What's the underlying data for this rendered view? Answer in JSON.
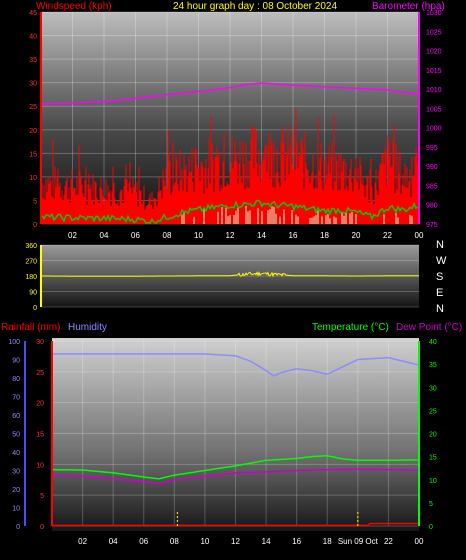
{
  "colors": {
    "background": "#000000",
    "wind_gust": "#ff0000",
    "wind_avg": "#00cc00",
    "wind_light": "#ccffcc",
    "barometer": "#ff00ff",
    "direction": "#ffff00",
    "rain": "#ff0000",
    "humidity": "#8c8cff",
    "temperature": "#00ff00",
    "dew_point": "#cc00cc",
    "axis_tick": "#ffff00",
    "left_axis_rain": "#4b4bff",
    "right_axis_temp": "#00ff00"
  },
  "chart_data": [
    {
      "id": "wind_baro",
      "type": "bar",
      "title": "24 hour graph day : 08 October 2024",
      "left_label": "Windspeed (kph)",
      "right_label": "Barometer (hpa)",
      "x_ticks": [
        "02",
        "04",
        "06",
        "08",
        "10",
        "12",
        "14",
        "16",
        "18",
        "20",
        "22",
        "00"
      ],
      "left_ticks": [
        "0",
        "5",
        "10",
        "15",
        "20",
        "25",
        "30",
        "35",
        "40",
        "45"
      ],
      "right_ticks": [
        "975",
        "980",
        "985",
        "990",
        "995",
        "1000",
        "1005",
        "1010",
        "1015",
        "1020",
        "1025",
        "1030"
      ],
      "ylim_left": [
        0,
        45
      ],
      "ylim_right": [
        975,
        1030
      ],
      "barometer": {
        "hours": [
          0,
          2,
          4,
          6,
          8,
          10,
          12,
          13,
          14,
          15,
          16,
          18,
          20,
          22,
          23,
          24
        ],
        "values": [
          1006.2,
          1006.4,
          1006.8,
          1007.6,
          1008.6,
          1009.4,
          1010.4,
          1011.2,
          1011.6,
          1011.3,
          1011.0,
          1010.6,
          1010.2,
          1009.8,
          1009.2,
          1008.8
        ]
      },
      "wind_gust_envelope": {
        "hours": [
          0,
          2,
          4,
          6,
          7,
          8,
          10,
          12,
          14,
          16,
          18,
          20,
          21,
          22,
          23,
          24
        ],
        "values": [
          13,
          12,
          11,
          10,
          7,
          15,
          18,
          20,
          22,
          21,
          18,
          16,
          10,
          20,
          15,
          16
        ]
      },
      "wind_avg": {
        "hours": [
          0,
          2,
          4,
          6,
          7,
          8,
          9,
          10,
          11,
          12,
          13,
          14,
          15,
          16,
          17,
          18,
          19,
          20,
          21,
          22,
          23,
          24
        ],
        "values": [
          1.5,
          1.3,
          1.2,
          1.0,
          0.5,
          1.5,
          2.5,
          3.0,
          3.5,
          4.0,
          4.2,
          4.5,
          4.0,
          3.8,
          3.2,
          2.8,
          3.0,
          2.5,
          1.5,
          3.5,
          3.0,
          4.0
        ]
      }
    },
    {
      "id": "direction",
      "type": "line",
      "left_ticks": [
        "0",
        "90",
        "180",
        "270",
        "360"
      ],
      "compass": [
        "N",
        "W",
        "S",
        "E",
        "N"
      ],
      "x_ticks": [],
      "ylim": [
        0,
        360
      ],
      "hours": [
        0,
        4,
        8,
        12,
        13,
        14,
        15,
        16,
        20,
        24
      ],
      "values": [
        180,
        178,
        180,
        182,
        190,
        195,
        188,
        182,
        180,
        182
      ]
    },
    {
      "id": "temp_hum",
      "type": "line",
      "rain_label": "Rainfall (mm)",
      "humidity_label": "Humidity",
      "temp_label": "Temperature (°C)",
      "dew_label": "Dew Point (°C)",
      "x_ticks": [
        "02",
        "04",
        "06",
        "08",
        "10",
        "12",
        "14",
        "16",
        "18",
        "Sun 09 Oct",
        "22",
        "00"
      ],
      "humidity_ticks": [
        "0",
        "10",
        "20",
        "30",
        "40",
        "50",
        "60",
        "70",
        "80",
        "90",
        "100"
      ],
      "rain_ticks": [
        "0",
        "5",
        "10",
        "15",
        "20",
        "25",
        "30"
      ],
      "temp_ticks": [
        "0",
        "5",
        "10",
        "15",
        "20",
        "25",
        "30",
        "35",
        "40"
      ],
      "ylim_humidity": [
        0,
        100
      ],
      "ylim_rain": [
        0,
        30
      ],
      "ylim_temp": [
        0,
        40
      ],
      "humidity": {
        "hours": [
          0,
          2,
          4,
          6,
          8,
          10,
          12,
          13,
          14,
          14.5,
          15,
          16,
          17,
          18,
          19,
          20,
          22,
          23,
          24
        ],
        "values": [
          93,
          93,
          93,
          93,
          93,
          93,
          92,
          89,
          84,
          81,
          83,
          85,
          84,
          82,
          86,
          90,
          91,
          89,
          87
        ]
      },
      "temperature": {
        "hours": [
          0,
          2,
          4,
          6,
          7,
          8,
          10,
          12,
          14,
          16,
          17,
          18,
          19,
          20,
          22,
          24
        ],
        "values": [
          12.2,
          12.1,
          11.5,
          10.6,
          10.2,
          11.0,
          12.0,
          13.0,
          14.2,
          14.6,
          15.0,
          15.2,
          14.5,
          14.2,
          14.2,
          14.3
        ]
      },
      "dew_point": {
        "hours": [
          0,
          2,
          4,
          6,
          7,
          8,
          10,
          12,
          14,
          16,
          18,
          20,
          22,
          24
        ],
        "values": [
          11.0,
          10.8,
          10.3,
          9.6,
          9.2,
          10.0,
          10.8,
          11.5,
          11.7,
          12.0,
          12.2,
          12.3,
          12.2,
          12.1
        ]
      },
      "rainfall": {
        "hours": [
          0,
          20.7,
          20.8,
          24
        ],
        "values": [
          0.1,
          0.1,
          0.4,
          0.4
        ]
      },
      "markers_hours": [
        8.2,
        20.0
      ]
    }
  ]
}
